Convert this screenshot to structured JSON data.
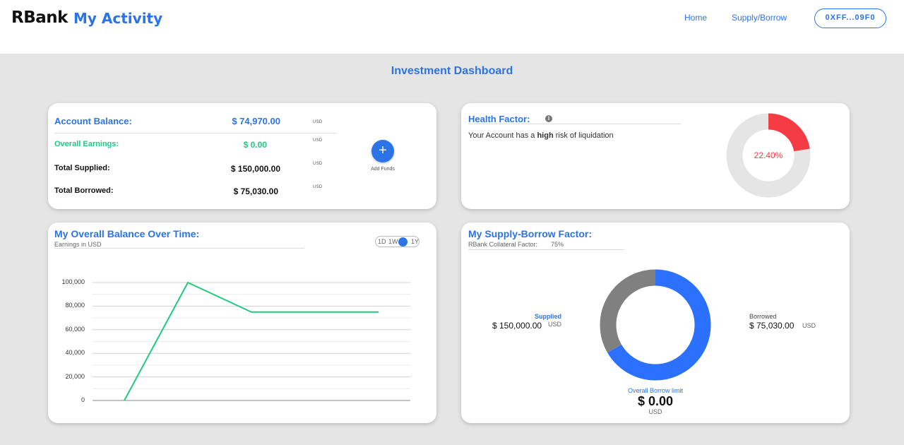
{
  "header": {
    "brand": "RBank",
    "title": "My Activity",
    "nav": {
      "home": "Home",
      "supply_borrow": "Supply/Borrow"
    },
    "wallet": "0XFF...09F0"
  },
  "dashboard_title": "Investment Dashboard",
  "balance_card": {
    "account_balance_label": "Account Balance:",
    "account_balance_value": "$ 74,970.00",
    "earnings_label": "Overall Earnings:",
    "earnings_value": "$ 0.00",
    "supplied_label": "Total Supplied:",
    "supplied_value": "$ 150,000.00",
    "borrowed_label": "Total Borrowed:",
    "borrowed_value": "$ 75,030.00",
    "unit": "USD",
    "add_funds_icon": "+",
    "add_funds_label": "Add Funds"
  },
  "health_card": {
    "title": "Health Factor:",
    "info_icon": "i",
    "text_before": "Your Account has a ",
    "risk_word": "high",
    "text_after": " risk of liquidation",
    "percent_label": "22.40%",
    "percent": 22.4,
    "color_risk": "#f53c45",
    "color_track": "#e5e5e5"
  },
  "balance_chart_card": {
    "title": "My Overall Balance Over Time:",
    "subtitle": "Earnings in USD",
    "toggle": {
      "left_a": "1D",
      "left_b": "1W",
      "right": "1Y"
    }
  },
  "supply_borrow_card": {
    "title": "My Supply-Borrow Factor:",
    "collateral_label": "RBank Collateral Factor:",
    "collateral_value": "75%",
    "supplied_label": "Supplied",
    "supplied_value": "$ 150,000.00",
    "borrowed_label": "Borrowed",
    "borrowed_value": "$ 75,030.00",
    "unit": "USD",
    "limit_label": "Overall Borrow limit",
    "limit_value": "$ 0.00",
    "limit_unit": "USD",
    "color_supplied": "#2b70ff",
    "color_borrowed": "#808080"
  },
  "chart_data": [
    {
      "type": "line",
      "y_ticks": [
        "100,000",
        "80,000",
        "60,000",
        "40,000",
        "20,000",
        "0"
      ],
      "ylim": [
        0,
        100000
      ],
      "x": [
        0,
        1,
        2,
        3,
        4
      ],
      "series": [
        {
          "values": [
            0,
            100000,
            75000,
            75000,
            75000
          ],
          "color": "#1ecb7e"
        }
      ],
      "grid": true
    },
    {
      "type": "pie",
      "labels": [
        "Supplied",
        "Borrowed"
      ],
      "values": [
        150000,
        75030
      ],
      "colors": [
        "#2b70ff",
        "#808080"
      ]
    }
  ]
}
